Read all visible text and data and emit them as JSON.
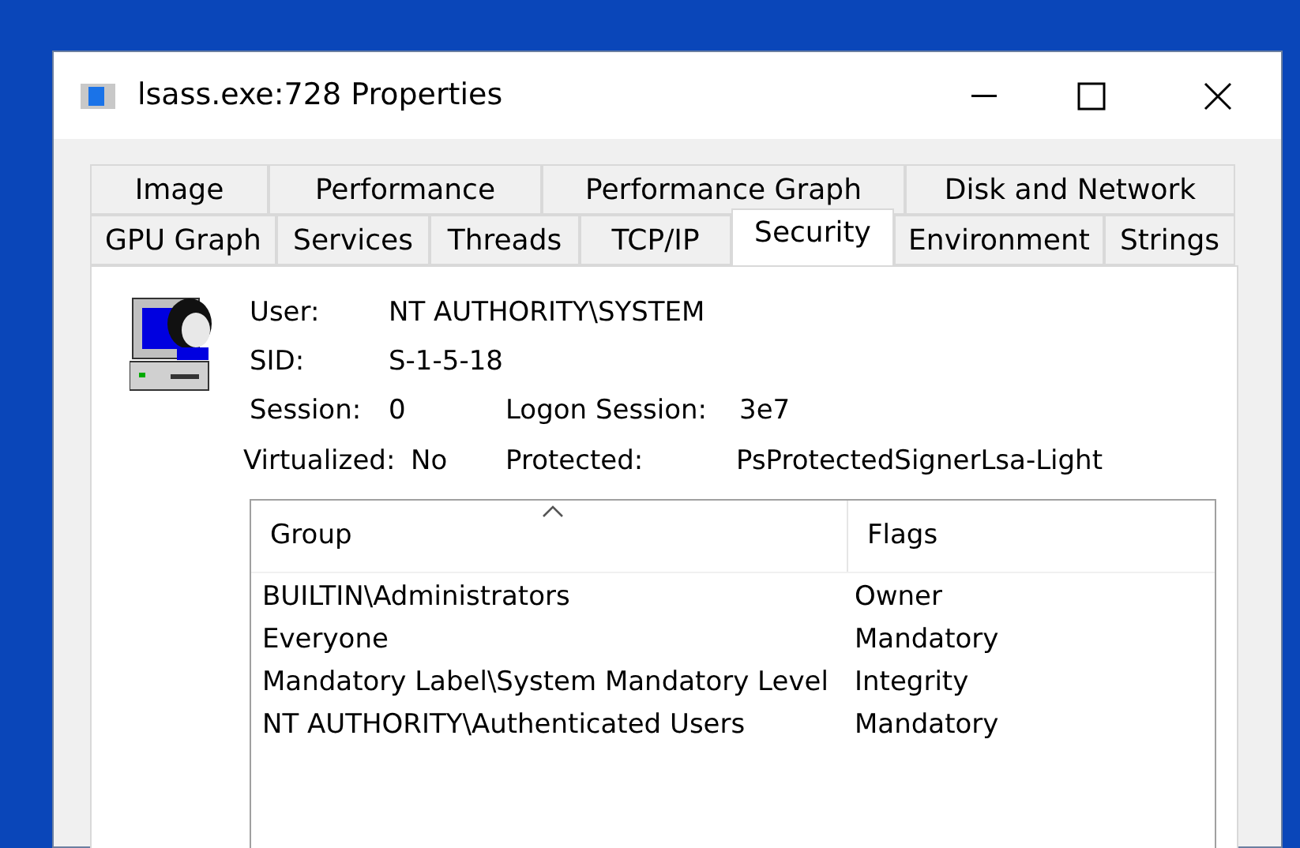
{
  "window": {
    "title": "lsass.exe:728 Properties"
  },
  "tab_rows": [
    [
      {
        "label": "Image",
        "selected": false
      },
      {
        "label": "Performance",
        "selected": false
      },
      {
        "label": "Performance Graph",
        "selected": false
      },
      {
        "label": "Disk and Network",
        "selected": false
      }
    ],
    [
      {
        "label": "GPU Graph",
        "selected": false
      },
      {
        "label": "Services",
        "selected": false
      },
      {
        "label": "Threads",
        "selected": false
      },
      {
        "label": "TCP/IP",
        "selected": false
      },
      {
        "label": "Security",
        "selected": true
      },
      {
        "label": "Environment",
        "selected": false
      },
      {
        "label": "Strings",
        "selected": false
      }
    ]
  ],
  "fields": {
    "user_label": "User:",
    "user": "NT AUTHORITY\\SYSTEM",
    "sid_label": "SID:",
    "sid": "S-1-5-18",
    "session_label": "Session:",
    "session": "0",
    "logon_session_label": "Logon Session:",
    "logon_session": "3e7",
    "virtualized_label": "Virtualized:",
    "virtualized": "No",
    "protected_label": "Protected:",
    "protected": "PsProtectedSignerLsa-Light"
  },
  "table": {
    "columns": [
      {
        "label": "Group",
        "sorted": true
      },
      {
        "label": "Flags",
        "sorted": false
      }
    ],
    "rows": [
      [
        "BUILTIN\\Administrators",
        "Owner"
      ],
      [
        "Everyone",
        "Mandatory"
      ],
      [
        "Mandatory Label\\System Mandatory Level",
        "Integrity"
      ],
      [
        "NT AUTHORITY\\Authenticated Users",
        "Mandatory"
      ]
    ]
  }
}
